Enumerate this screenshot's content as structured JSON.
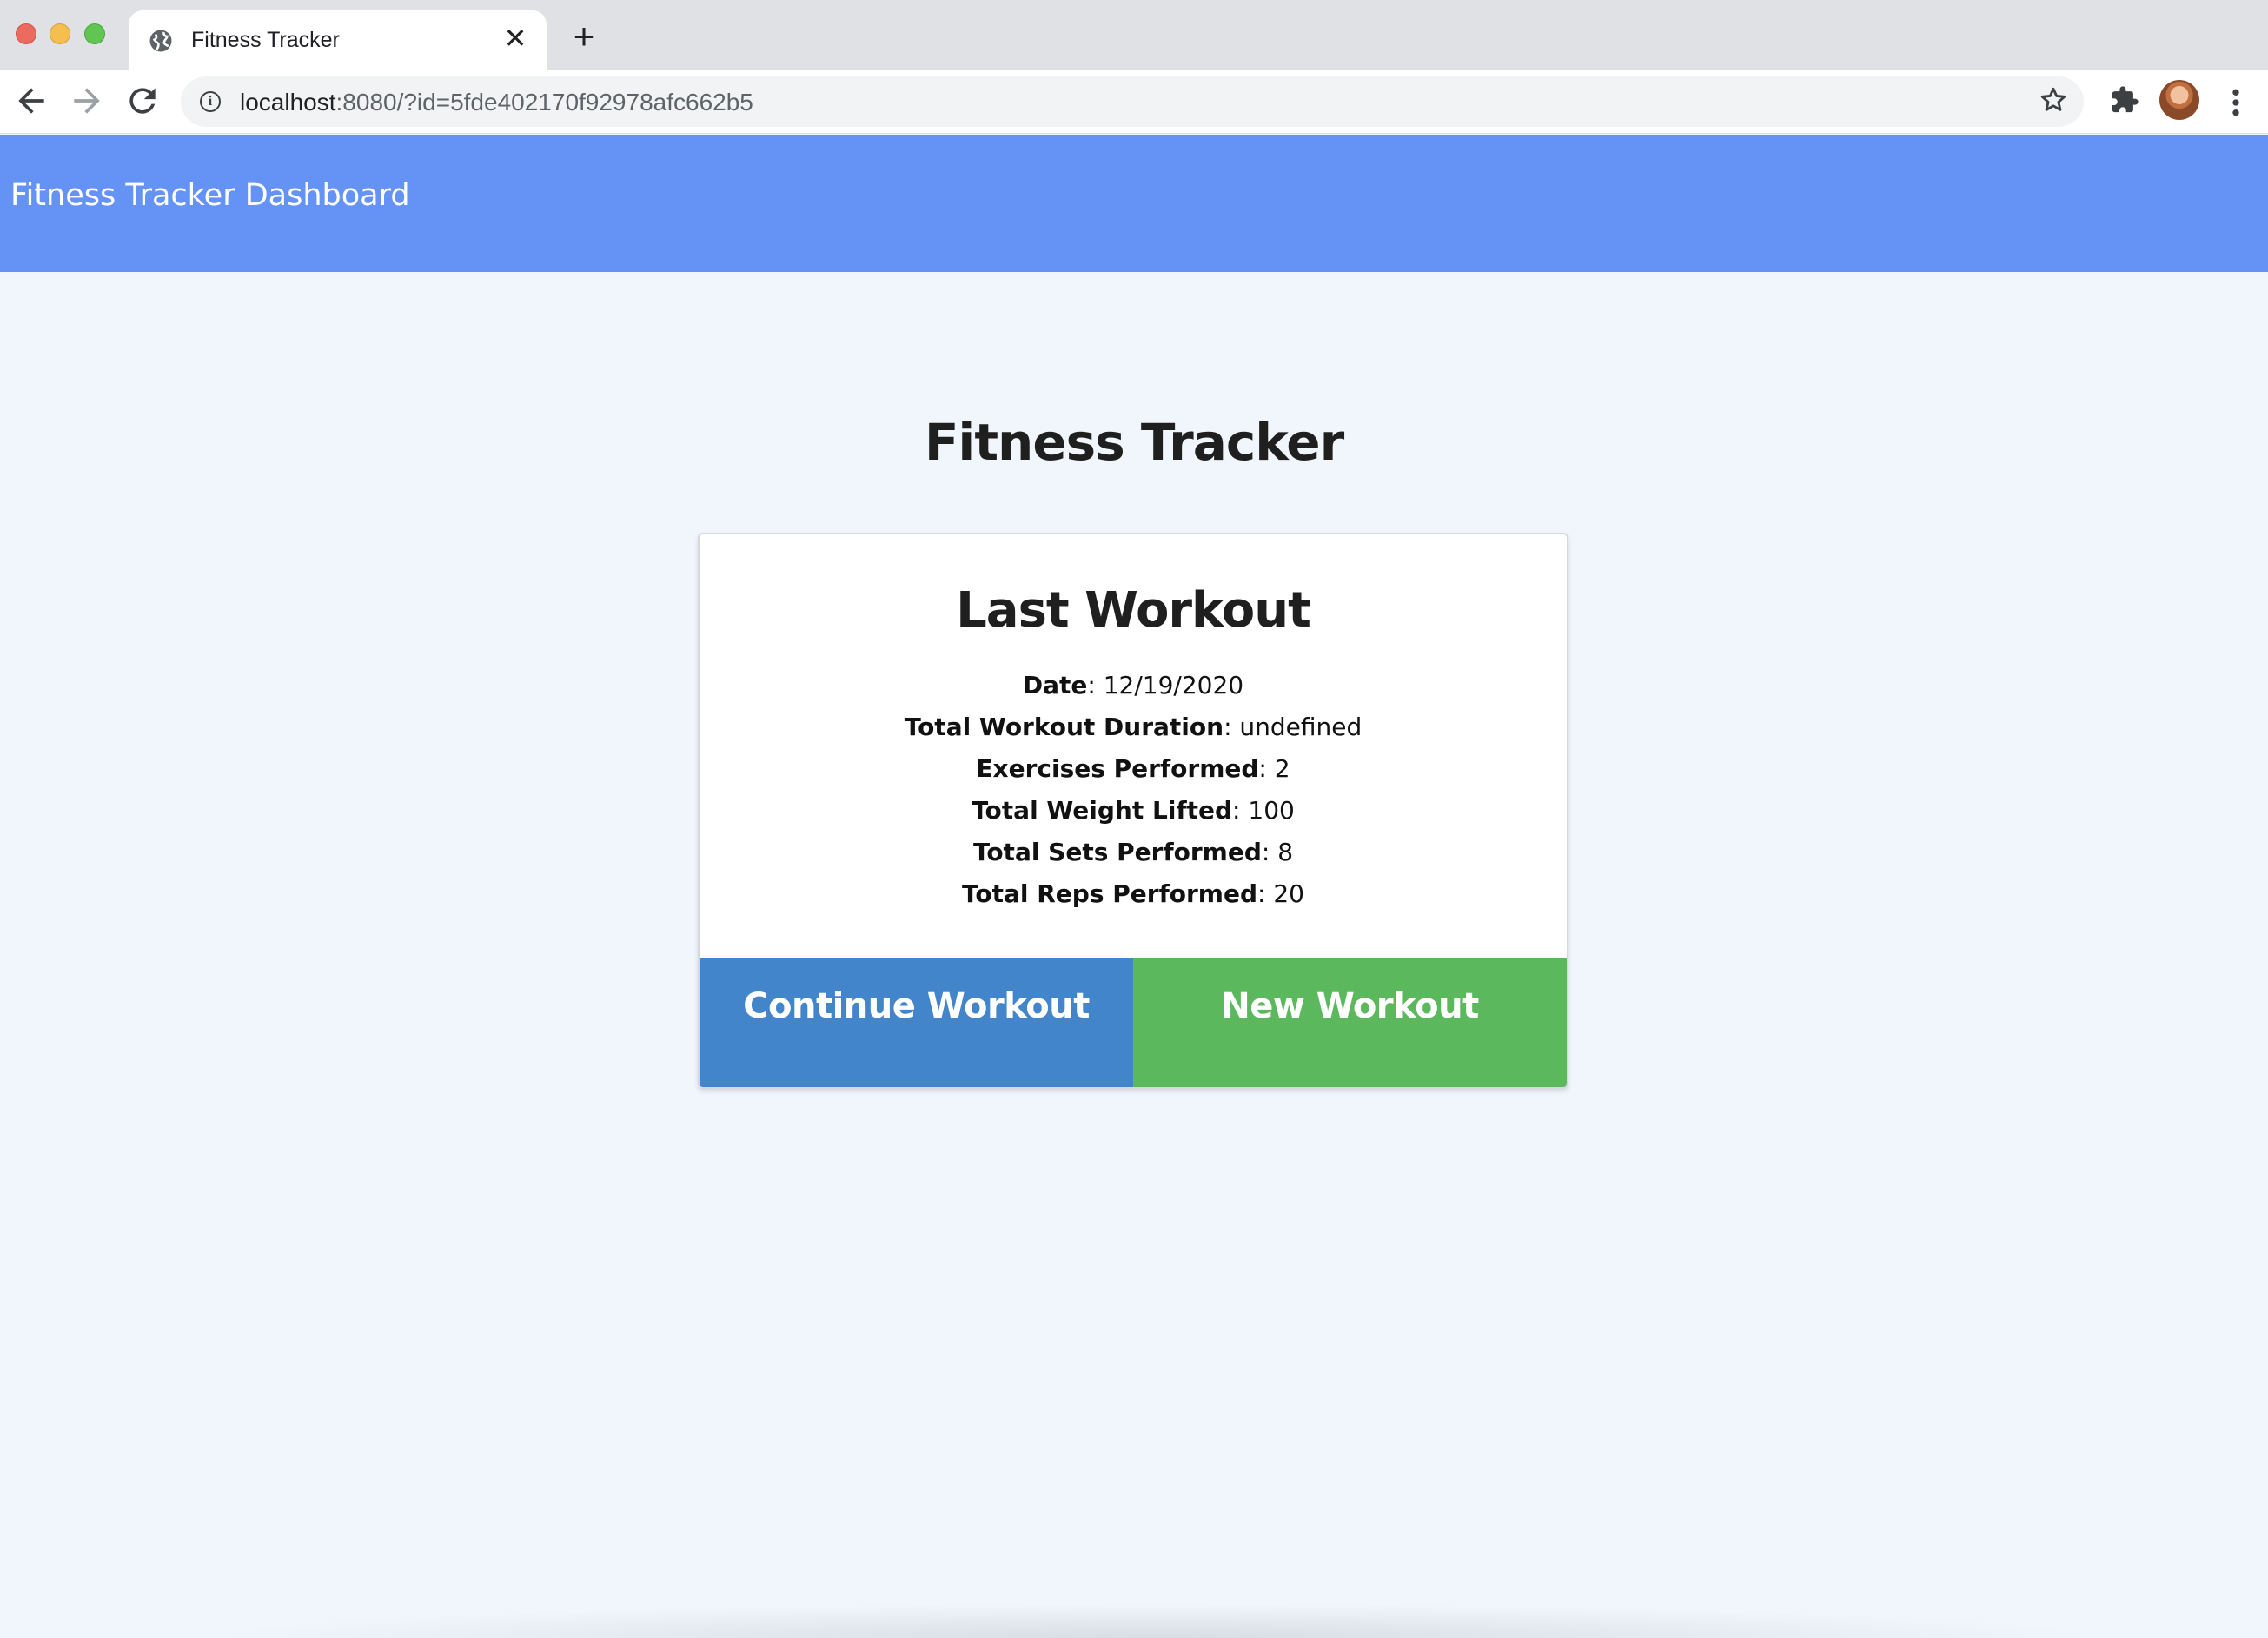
{
  "browser": {
    "tab_title": "Fitness Tracker",
    "tab_close": "✕",
    "new_tab": "+",
    "url_host": "localhost",
    "url_rest": ":8080/?id=5fde402170f92978afc662b5",
    "icons": {
      "back": "back-arrow-icon",
      "forward": "forward-arrow-icon",
      "reload": "reload-icon",
      "info": "info-icon",
      "bookmark": "star-icon",
      "extensions": "puzzle-icon",
      "menu": "kebab-menu-icon",
      "favicon": "globe-icon"
    }
  },
  "navbar": {
    "brand": "Fitness Tracker Dashboard",
    "color": "#6593f5"
  },
  "main": {
    "title": "Fitness Tracker"
  },
  "card": {
    "title": "Last Workout",
    "stats": [
      {
        "label": "Date",
        "value": ": 12/19/2020"
      },
      {
        "label": "Total Workout Duration",
        "value": ": undefined"
      },
      {
        "label": "Exercises Performed",
        "value": ": 2"
      },
      {
        "label": "Total Weight Lifted",
        "value": ": 100"
      },
      {
        "label": "Total Sets Performed",
        "value": ": 8"
      },
      {
        "label": "Total Reps Performed",
        "value": ": 20"
      }
    ],
    "continue_label": "Continue Workout",
    "new_label": "New Workout",
    "continue_color": "#4285cb",
    "new_color": "#5cb85c"
  }
}
